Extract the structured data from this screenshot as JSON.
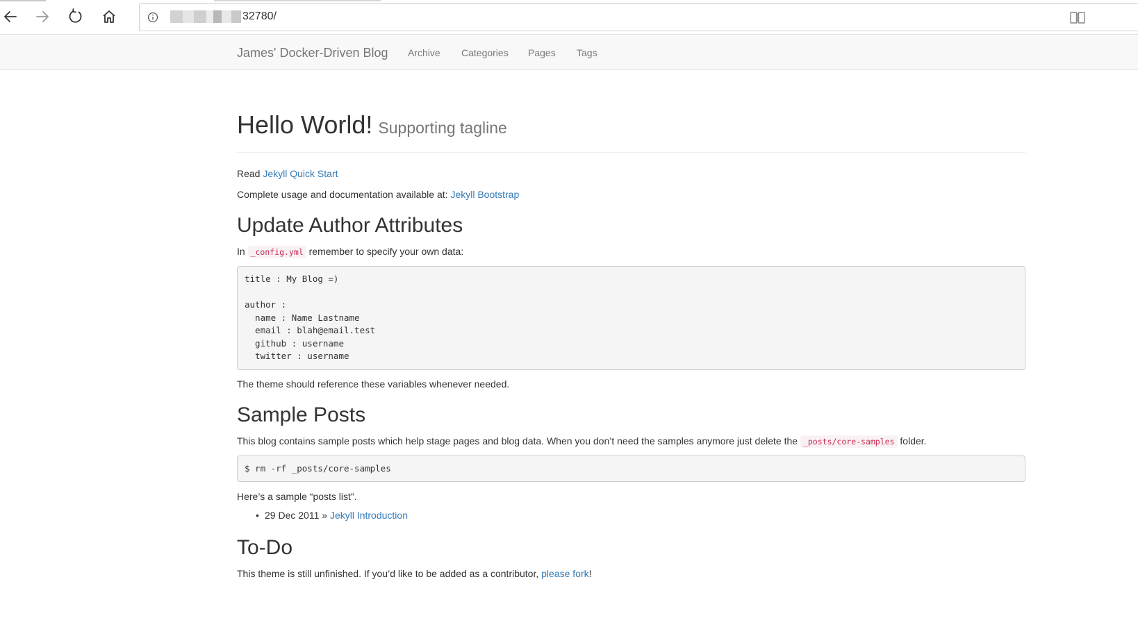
{
  "browser": {
    "back_icon": "back-arrow-icon",
    "forward_icon": "forward-arrow-icon",
    "refresh_icon": "refresh-icon",
    "home_icon": "home-icon",
    "info_icon": "info-icon",
    "reading_view_icon": "reading-view-icon",
    "url": "32780/"
  },
  "navbar": {
    "brand": "James' Docker-Driven Blog",
    "items": [
      "Archive",
      "Categories",
      "Pages",
      "Tags"
    ]
  },
  "page": {
    "title": "Hello World!",
    "tagline": "Supporting tagline",
    "intro": {
      "read_prefix": "Read",
      "read_link": "Jekyll Quick Start",
      "docs_prefix": "Complete usage and documentation available at:",
      "docs_link": "Jekyll Bootstrap"
    },
    "author_section": {
      "heading": "Update Author Attributes",
      "text_before": "In",
      "code": "_config.yml",
      "text_after": "remember to specify your own data:",
      "config_code": "title : My Blog =)\n\nauthor :\n  name : Name Lastname\n  email : blah@email.test\n  github : username\n  twitter : username",
      "note": "The theme should reference these variables whenever needed."
    },
    "samples_section": {
      "heading": "Sample Posts",
      "text_before": "This blog contains sample posts which help stage pages and blog data. When you don’t need the samples anymore just delete the",
      "code": "_posts/core-samples",
      "text_after": "folder.",
      "command": "$ rm -rf _posts/core-samples",
      "list_intro": "Here’s a sample “posts list”.",
      "posts": [
        {
          "date": "29 Dec 2011",
          "separator": "»",
          "title": "Jekyll Introduction"
        }
      ]
    },
    "todo_section": {
      "heading": "To-Do",
      "text_before": "This theme is still unfinished. If you’d like to be added as a contributor,",
      "link": "please fork",
      "text_after": "!"
    }
  },
  "colors": {
    "link": "#337ab7",
    "inline_code": "#c7254e",
    "navbar_bg": "#f8f8f8",
    "muted": "#777777"
  }
}
